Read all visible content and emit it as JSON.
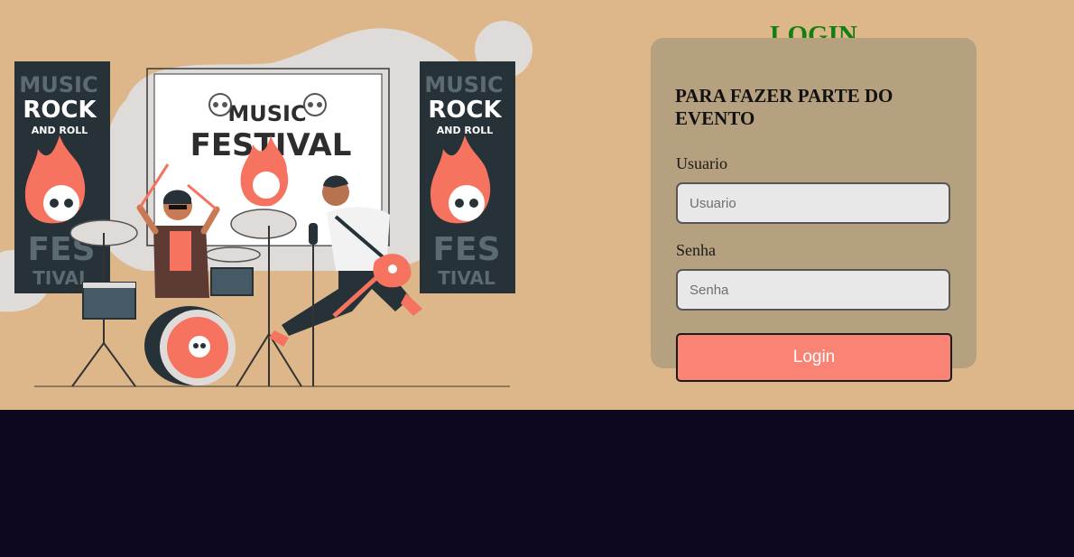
{
  "colors": {
    "page_background": "#ddb789",
    "footer_background": "#0d0820",
    "card_background": "#b5a07f",
    "title_color": "#117f11",
    "button_color": "#f98375",
    "accent_coral": "#f5735f"
  },
  "illustration": {
    "banner_left": {
      "line1": "MUSIC",
      "line2": "ROCK",
      "line3": "AND ROLL",
      "line4": "FES",
      "line5": "TIVAL"
    },
    "banner_right": {
      "line1": "MUSIC",
      "line2": "ROCK",
      "line3": "AND ROLL",
      "line4": "FES",
      "line5": "TIVAL"
    },
    "screen": {
      "line1": "MUSIC",
      "line2": "FESTIVAL"
    },
    "icons": [
      "skull-icon",
      "drum-kit",
      "drummer",
      "guitarist",
      "guitar"
    ]
  },
  "login": {
    "title": "LOGIN",
    "subtitle": "PARA FAZER PARTE DO EVENTO",
    "username_label": "Usuario",
    "username_placeholder": "Usuario",
    "username_value": "",
    "password_label": "Senha",
    "password_placeholder": "Senha",
    "password_value": "",
    "button_label": "Login"
  }
}
